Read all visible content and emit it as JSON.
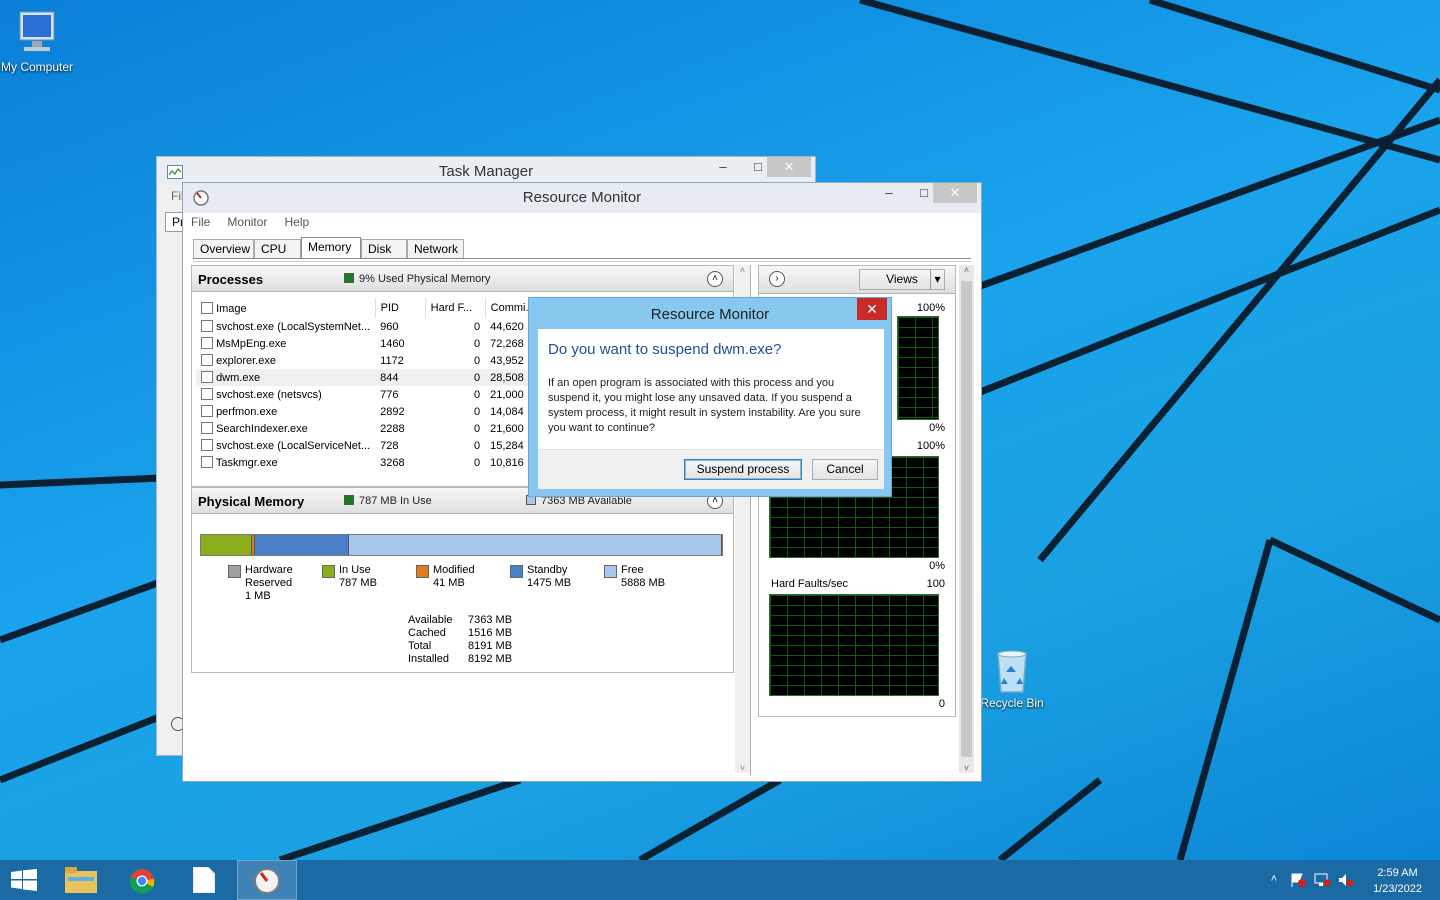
{
  "desktop": {
    "icons": [
      {
        "label": "My Computer"
      },
      {
        "label": "Recycle Bin"
      }
    ]
  },
  "task_manager": {
    "title": "Task Manager",
    "menu_fragment": "Fil",
    "tab_fragment": "Pr"
  },
  "resource_monitor": {
    "title": "Resource Monitor",
    "menu": [
      "File",
      "Monitor",
      "Help"
    ],
    "tabs": [
      "Overview",
      "CPU",
      "Memory",
      "Disk",
      "Network"
    ],
    "active_tab": "Memory",
    "processes": {
      "title": "Processes",
      "info": "9% Used Physical Memory",
      "columns": [
        "Image",
        "PID",
        "Hard F...",
        "Commi..."
      ],
      "rows": [
        {
          "image": "svchost.exe (LocalSystemNet...",
          "pid": "960",
          "hard": "0",
          "commit": "44,620"
        },
        {
          "image": "MsMpEng.exe",
          "pid": "1460",
          "hard": "0",
          "commit": "72,268"
        },
        {
          "image": "explorer.exe",
          "pid": "1172",
          "hard": "0",
          "commit": "43,952"
        },
        {
          "image": "dwm.exe",
          "pid": "844",
          "hard": "0",
          "commit": "28,508"
        },
        {
          "image": "svchost.exe (netsvcs)",
          "pid": "776",
          "hard": "0",
          "commit": "21,000"
        },
        {
          "image": "perfmon.exe",
          "pid": "2892",
          "hard": "0",
          "commit": "14,084"
        },
        {
          "image": "SearchIndexer.exe",
          "pid": "2288",
          "hard": "0",
          "commit": "21,600"
        },
        {
          "image": "svchost.exe (LocalServiceNet...",
          "pid": "728",
          "hard": "0",
          "commit": "15,284"
        },
        {
          "image": "Taskmgr.exe",
          "pid": "3268",
          "hard": "0",
          "commit": "10,816"
        }
      ]
    },
    "physical_memory": {
      "title": "Physical Memory",
      "in_use_info": "787 MB In Use",
      "available_info": "7363 MB Available",
      "bar": [
        {
          "name": "Hardware Reserved",
          "fraction": 0.0001,
          "color": "#a0a0a0"
        },
        {
          "name": "In Use",
          "fraction": 0.096,
          "color": "#8cae1c"
        },
        {
          "name": "Modified",
          "fraction": 0.005,
          "color": "#e07c1e"
        },
        {
          "name": "Standby",
          "fraction": 0.18,
          "color": "#4a7fc8"
        },
        {
          "name": "Free",
          "fraction": 0.7189,
          "color": "#a9c6ec"
        }
      ],
      "legend": [
        {
          "label": "Hardware Reserved",
          "line1": "Hardware",
          "line2": "Reserved",
          "value": "1 MB",
          "color": "#a0a0a0"
        },
        {
          "label": "In Use",
          "line1": "In Use",
          "line2": "",
          "value": "787 MB",
          "color": "#8cae1c"
        },
        {
          "label": "Modified",
          "line1": "Modified",
          "line2": "",
          "value": "41 MB",
          "color": "#e07c1e"
        },
        {
          "label": "Standby",
          "line1": "Standby",
          "line2": "",
          "value": "1475 MB",
          "color": "#4a7fc8"
        },
        {
          "label": "Free",
          "line1": "Free",
          "line2": "",
          "value": "5888 MB",
          "color": "#a9c6ec"
        }
      ],
      "stats": [
        {
          "label": "Available",
          "value": "7363 MB"
        },
        {
          "label": "Cached",
          "value": "1516 MB"
        },
        {
          "label": "Total",
          "value": "8191 MB"
        },
        {
          "label": "Installed",
          "value": "8192 MB"
        }
      ]
    },
    "graphs": {
      "views_label": "Views",
      "g1_top": "100%",
      "g1_bottom": "0%",
      "g2_top": "100%",
      "g2_bottom": "0%",
      "g3_title": "Hard Faults/sec",
      "g3_top": "100",
      "g3_bottom": "0"
    }
  },
  "dialog": {
    "title": "Resource Monitor",
    "question": "Do you want to suspend dwm.exe?",
    "message": "If an open program is associated with this process and you suspend it, you might lose any unsaved data. If you suspend a system process, it might result in system instability. Are you sure you want to continue?",
    "confirm_label": "Suspend process",
    "cancel_label": "Cancel"
  },
  "taskbar": {
    "time": "2:59 AM",
    "date": "1/23/2022"
  }
}
